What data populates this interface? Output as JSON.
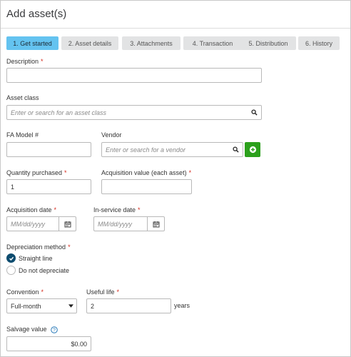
{
  "dialog": {
    "title": "Add asset(s)"
  },
  "tabs": [
    {
      "label": "1. Get started",
      "active": true
    },
    {
      "label": "2. Asset details",
      "active": false
    },
    {
      "label": "3. Attachments",
      "active": false
    },
    {
      "label": "4. Transaction",
      "active": false
    },
    {
      "label": "5. Distribution",
      "active": false
    },
    {
      "label": "6. History",
      "active": false
    }
  ],
  "form": {
    "description": {
      "label": "Description",
      "required": "*",
      "value": ""
    },
    "asset_class": {
      "label": "Asset class",
      "placeholder": "Enter or search for an asset class"
    },
    "fa_model": {
      "label": "FA Model #",
      "value": ""
    },
    "vendor": {
      "label": "Vendor",
      "placeholder": "Enter or search for a vendor"
    },
    "quantity": {
      "label": "Quantity purchased",
      "required": "*",
      "value": "1"
    },
    "acq_value": {
      "label": "Acquisition value (each asset)",
      "required": "*",
      "value": ""
    },
    "acq_date": {
      "label": "Acquisition date",
      "required": "*",
      "placeholder": "MM/dd/yyyy"
    },
    "inservice_date": {
      "label": "In-service date",
      "required": "*",
      "placeholder": "MM/dd/yyyy"
    },
    "depreciation": {
      "label": "Depreciation method",
      "required": "*",
      "options": [
        "Straight line",
        "Do not depreciate"
      ],
      "selected": "Straight line"
    },
    "convention": {
      "label": "Convention",
      "required": "*",
      "value": "Full-month"
    },
    "useful_life": {
      "label": "Useful life",
      "required": "*",
      "value": "2",
      "suffix": "years"
    },
    "salvage": {
      "label": "Salvage value",
      "value": "$0.00"
    }
  },
  "colors": {
    "accent_tab": "#64c3f0",
    "add_button": "#2ca01c",
    "radio_checked": "#0d4c6f",
    "required": "#d52b1e"
  }
}
